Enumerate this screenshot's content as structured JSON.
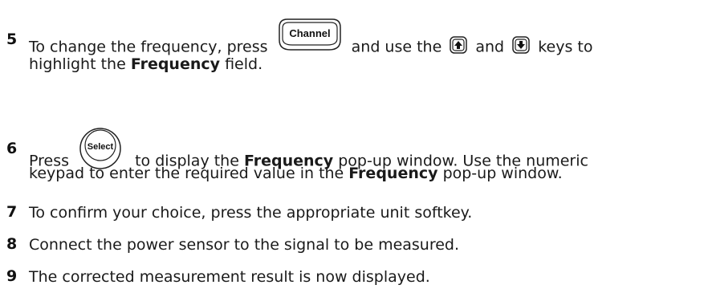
{
  "steps": [
    {
      "number": "5",
      "line1_a": "To change the frequency, press",
      "line1_b": "and use the",
      "line1_c": "and",
      "line1_d": "keys to",
      "line2_a": "highlight the",
      "line2_bold": "Frequency",
      "line2_b": "field."
    },
    {
      "number": "6",
      "line1_a": "Press",
      "line1_b": "to display the",
      "line1_bold": "Frequency",
      "line1_c": "pop-up window. Use the numeric",
      "line2_a": "keypad to enter the required value in the",
      "line2_bold": "Frequency",
      "line2_b": "pop-up window."
    },
    {
      "number": "7",
      "text": "To confirm your choice, press the appropriate unit softkey."
    },
    {
      "number": "8",
      "text": "Connect the power sensor to the signal to be measured."
    },
    {
      "number": "9",
      "text": "The corrected measurement result is now displayed."
    }
  ],
  "keys": {
    "channel_label": "Channel",
    "select_label": "Select",
    "up_arrow_icon": "up-arrow-key-icon",
    "down_arrow_icon": "down-arrow-key-icon"
  }
}
